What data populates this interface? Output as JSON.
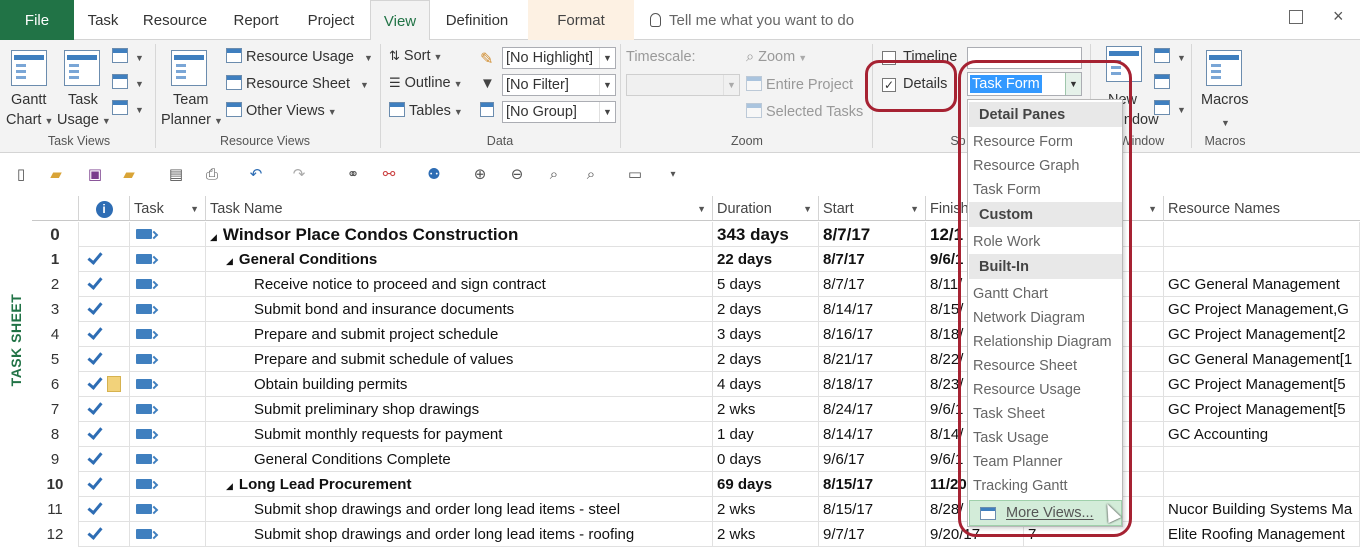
{
  "tabs": [
    {
      "label": "File",
      "type": "file"
    },
    {
      "label": "Task"
    },
    {
      "label": "Resource"
    },
    {
      "label": "Report"
    },
    {
      "label": "Project"
    },
    {
      "label": "View",
      "type": "active"
    },
    {
      "label": "Definition"
    },
    {
      "label": "Format",
      "type": "format"
    }
  ],
  "tellme": "Tell me what you want to do",
  "ribbon": {
    "task_views": {
      "gantt_l1": "Gantt",
      "gantt_l2": "Chart",
      "usage_l1": "Task",
      "usage_l2": "Usage",
      "group": "Task Views"
    },
    "resource_views": {
      "planner_l1": "Team",
      "planner_l2": "Planner",
      "resource_usage": "Resource Usage",
      "resource_sheet": "Resource Sheet",
      "other_views": "Other Views",
      "group": "Resource Views"
    },
    "data": {
      "sort": "Sort",
      "outline": "Outline",
      "tables": "Tables",
      "highlight": "[No Highlight]",
      "filter": "[No Filter]",
      "group_by": "[No Group]",
      "group": "Data"
    },
    "zoom": {
      "timescale": "Timescale:",
      "zoom": "Zoom",
      "entire_project": "Entire Project",
      "selected_tasks": "Selected Tasks",
      "group": "Zoom"
    },
    "split": {
      "timeline": "Timeline",
      "details": "Details",
      "details_checked": true,
      "group_partial": "Sp"
    },
    "window": {
      "new_l1": "New",
      "new_l2": "Window",
      "group": "Window"
    },
    "macros": {
      "label": "Macros",
      "group": "Macros"
    }
  },
  "view_combo": {
    "value": "Task Form"
  },
  "dropdown": {
    "headers": [
      "Detail Panes",
      "Custom",
      "Built-In"
    ],
    "detail_panes": [
      "Resource Form",
      "Resource Graph",
      "Task Form"
    ],
    "custom": [
      "Role Work"
    ],
    "builtin": [
      "Gantt Chart",
      "Network Diagram",
      "Relationship Diagram",
      "Resource Sheet",
      "Resource Usage",
      "Task Sheet",
      "Task Usage",
      "Team Planner",
      "Tracking Gantt"
    ],
    "more_views": "More Views..."
  },
  "sheet": {
    "side_label": "TASK SHEET",
    "columns": {
      "task_mode": "Task",
      "task_name": "Task Name",
      "duration": "Duration",
      "start": "Start",
      "finish": "Finish",
      "resource_names": "Resource Names"
    },
    "rows": [
      {
        "id": "0",
        "check": false,
        "name": "Windsor Place Condos Construction",
        "level": 0,
        "summary": true,
        "duration": "343 days",
        "start": "8/7/17",
        "finish": "12/1",
        "pred": "",
        "resources": ""
      },
      {
        "id": "1",
        "check": true,
        "name": "General Conditions",
        "level": 1,
        "summary": true,
        "duration": "22 days",
        "start": "8/7/17",
        "finish": "9/6/1",
        "pred": "",
        "resources": ""
      },
      {
        "id": "2",
        "check": true,
        "name": "Receive notice to proceed and sign contract",
        "level": 2,
        "duration": "5 days",
        "start": "8/7/17",
        "finish": "8/11/",
        "pred": "",
        "resources": "GC General Management"
      },
      {
        "id": "3",
        "check": true,
        "name": "Submit bond and insurance documents",
        "level": 2,
        "duration": "2 days",
        "start": "8/14/17",
        "finish": "8/15/",
        "pred": "",
        "resources": "GC Project Management,G"
      },
      {
        "id": "4",
        "check": true,
        "name": "Prepare and submit project schedule",
        "level": 2,
        "duration": "3 days",
        "start": "8/16/17",
        "finish": "8/18/",
        "pred": "",
        "resources": "GC Project Management[2"
      },
      {
        "id": "5",
        "check": true,
        "name": "Prepare and submit schedule of values",
        "level": 2,
        "duration": "2 days",
        "start": "8/21/17",
        "finish": "8/22/",
        "pred": "",
        "resources": "GC General Management[1"
      },
      {
        "id": "6",
        "check": true,
        "note": true,
        "name": "Obtain building permits",
        "level": 2,
        "duration": "4 days",
        "start": "8/18/17",
        "finish": "8/23/",
        "pred": "",
        "resources": "GC Project Management[5"
      },
      {
        "id": "7",
        "check": true,
        "name": "Submit preliminary shop drawings",
        "level": 2,
        "duration": "2 wks",
        "start": "8/24/17",
        "finish": "9/6/1",
        "pred": "",
        "resources": "GC Project Management[5"
      },
      {
        "id": "8",
        "check": true,
        "name": "Submit monthly requests for payment",
        "level": 2,
        "duration": "1 day",
        "start": "8/14/17",
        "finish": "8/14/",
        "pred": "",
        "resources": "GC Accounting"
      },
      {
        "id": "9",
        "check": true,
        "name": "General Conditions Complete",
        "level": 2,
        "duration": "0 days",
        "start": "9/6/17",
        "finish": "9/6/1",
        "pred": "",
        "resources": ""
      },
      {
        "id": "10",
        "check": true,
        "name": "Long Lead Procurement",
        "level": 1,
        "summary": true,
        "duration": "69 days",
        "start": "8/15/17",
        "finish": "11/20",
        "pred": "",
        "resources": ""
      },
      {
        "id": "11",
        "check": true,
        "name": "Submit shop drawings and order long lead items - steel",
        "level": 2,
        "duration": "2 wks",
        "start": "8/15/17",
        "finish": "8/28/",
        "pred": "",
        "resources": "Nucor Building Systems Ma"
      },
      {
        "id": "12",
        "check": true,
        "name": "Submit shop drawings and order long lead items - roofing",
        "level": 2,
        "duration": "2 wks",
        "start": "9/7/17",
        "finish": "9/20/17",
        "pred": "7",
        "resources": "Elite Roofing Management"
      }
    ]
  },
  "colors": {
    "accent": "#217346",
    "highlight_oval": "#a62232",
    "check": "#2e6db4"
  }
}
